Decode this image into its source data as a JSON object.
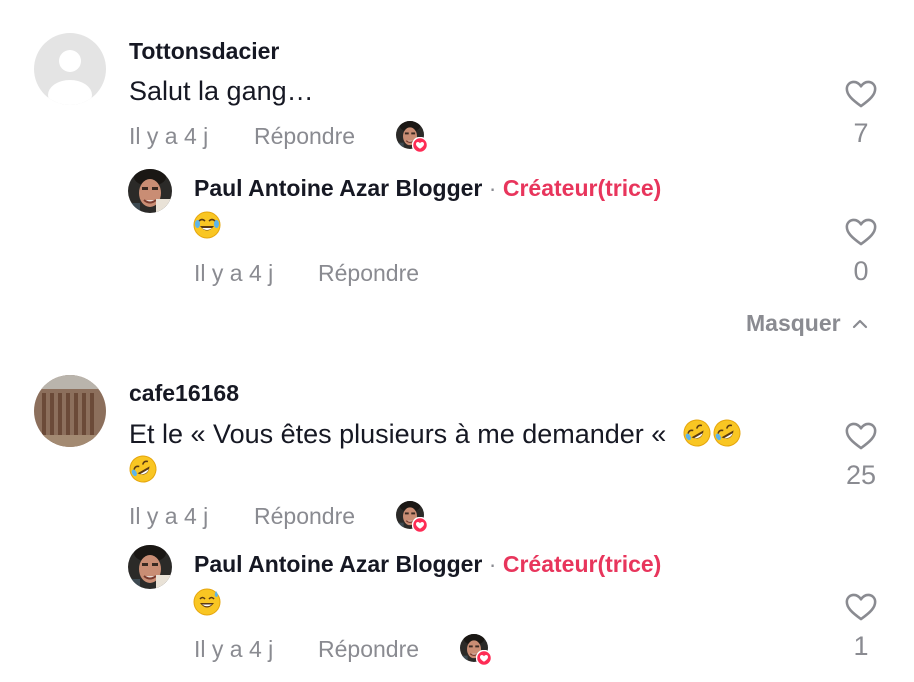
{
  "comments": [
    {
      "username": "Tottonsdacier",
      "text": "Salut la gang…",
      "time": "Il y a 4 j",
      "reply_label": "Répondre",
      "likes": "7",
      "reply": {
        "username": "Paul Antoine Azar Blogger",
        "separator": "·",
        "badge": "Créateur(trice)",
        "emoji": "face-with-tears-of-joy",
        "time": "Il y a 4 j",
        "reply_label": "Répondre",
        "likes": "0"
      }
    },
    {
      "username": "cafe16168",
      "text": "Et le «  Vous êtes plusieurs à me demander « ",
      "emoji_trailing": [
        "rolling-on-floor-laughing",
        "rolling-on-floor-laughing",
        "rolling-on-floor-laughing"
      ],
      "time": "Il y a 4 j",
      "reply_label": "Répondre",
      "likes": "25",
      "reply": {
        "username": "Paul Antoine Azar Blogger",
        "separator": "·",
        "badge": "Créateur(trice)",
        "emoji": "grinning-face-with-sweat",
        "time": "Il y a 4 j",
        "reply_label": "Répondre",
        "likes": "1"
      }
    }
  ],
  "hide_replies_label": "Masquer",
  "colors": {
    "creator": "#e8355c",
    "meta": "#8a8b91",
    "liked_badge": "#fe2c55"
  }
}
